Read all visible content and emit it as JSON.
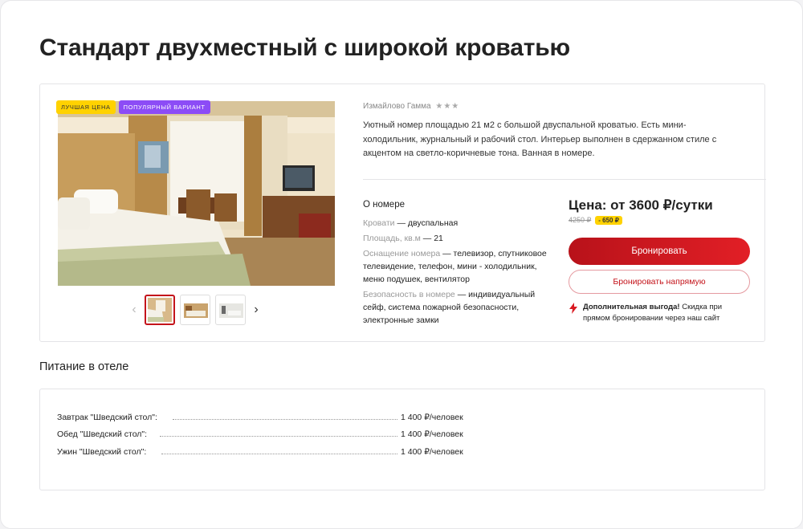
{
  "room": {
    "title": "Стандарт двухместный с широкой кроватью",
    "badges": [
      "ЛУЧШАЯ ЦЕНА",
      "ПОПУЛЯРНЫЙ ВАРИАНТ"
    ],
    "hotel_name": "Измайлово Гамма",
    "stars": "★★★",
    "description": "Уютный номер площадью 21 м2 с большой двуспальной кроватью. Есть мини-холодильник, журнальный и рабочий стол. Интерьер выполнен в сдержанном стиле с акцентом на светло-коричневые тона. Ванная в номере.",
    "about": {
      "title": "О номере",
      "rows": [
        {
          "key": "Кровати",
          "value": " — двуспальная"
        },
        {
          "key": "Площадь, кв.м",
          "value": " — 21"
        },
        {
          "key": "Оснащение номера",
          "value": " — телевизор, спутниковое телевидение, телефон, мини - холодильник, меню подушек, вентилятор"
        },
        {
          "key": "Безопасность в номере",
          "value": " — индивидуальный сейф, система пожарной безопасности, электронные замки"
        }
      ]
    },
    "price": {
      "label": "Цена: от 3600 ₽/сутки",
      "old_price": "4250 ₽",
      "discount": "- 650 ₽"
    },
    "buttons": {
      "book": "Бронировать",
      "book_direct": "Бронировать напрямую"
    },
    "bonus": {
      "strong": "Дополнительная выгода!",
      "text": " Скидка при прямом бронировании через наш сайт"
    },
    "gallery": {
      "prev_icon": "‹",
      "next_icon": "›"
    }
  },
  "meals": {
    "title": "Питание в отеле",
    "items": [
      {
        "name": "Завтрак \"Шведский стол\":",
        "price": "1 400 ₽/человек"
      },
      {
        "name": "Обед \"Шведский стол\":",
        "price": "1 400 ₽/человек"
      },
      {
        "name": "Ужин \"Шведский стол\":",
        "price": "1 400 ₽/человек"
      }
    ]
  },
  "colors": {
    "accent": "#c4141b",
    "badge_best": "#ffd200",
    "badge_popular": "#8c4cf6"
  }
}
